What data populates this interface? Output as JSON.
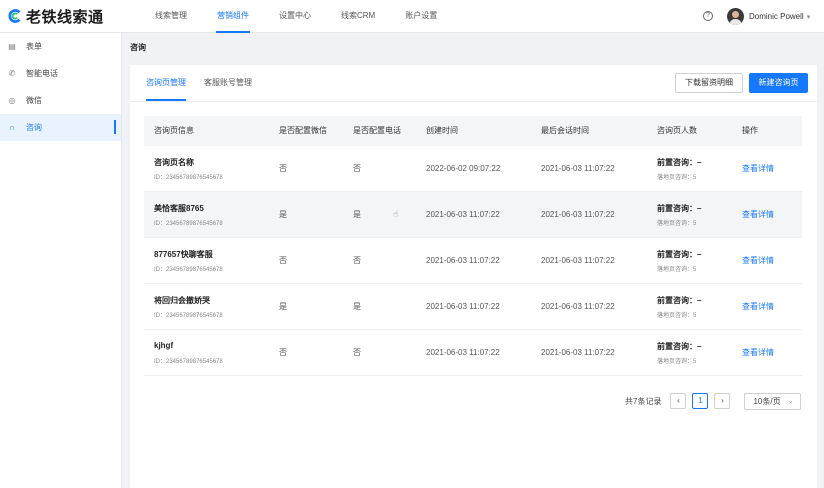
{
  "brand": {
    "name": "老铁线索通",
    "color": "#1677ff"
  },
  "topnav": {
    "items": [
      {
        "label": "线索管理"
      },
      {
        "label": "营销组件"
      },
      {
        "label": "设置中心"
      },
      {
        "label": "线索CRM"
      },
      {
        "label": "账户设置"
      }
    ],
    "active_index": 1,
    "help_glyph": "?",
    "user_name": "Dominic Powell"
  },
  "sidebar": {
    "items": [
      {
        "label": "表单",
        "icon": "form-icon"
      },
      {
        "label": "智能电话",
        "icon": "phone-icon"
      },
      {
        "label": "微信",
        "icon": "wechat-icon"
      },
      {
        "label": "咨询",
        "icon": "headset-icon"
      }
    ],
    "active_index": 3
  },
  "page": {
    "title": "咨询"
  },
  "tabs": [
    {
      "label": "咨询页管理"
    },
    {
      "label": "客服账号管理"
    }
  ],
  "actions": {
    "download": "下载留资明细",
    "create": "新建咨询页"
  },
  "table": {
    "columns": [
      "咨询页信息",
      "是否配置微信",
      "是否配置电话",
      "创建时间",
      "最后会话时间",
      "咨询页人数",
      "操作"
    ],
    "rows": [
      {
        "name": "咨询页名称",
        "id": "ID：23456789876545678",
        "wechat": "否",
        "phone": "否",
        "created": "2022-06-02 09:07:22",
        "last": "2021-06-03 11:07:22",
        "consult": "前置咨询：–",
        "landing": "落地页咨询：5",
        "action": "查看详情"
      },
      {
        "name": "美恰客服8765",
        "id": "ID：23456789876545678",
        "wechat": "是",
        "phone": "是",
        "created": "2021-06-03 11:07:22",
        "last": "2021-06-03 11:07:22",
        "consult": "前置咨询：–",
        "landing": "落地页咨询：5",
        "action": "查看详情"
      },
      {
        "name": "877657快聊客服",
        "id": "ID：23456789876545678",
        "wechat": "否",
        "phone": "否",
        "created": "2021-06-03 11:07:22",
        "last": "2021-06-03 11:07:22",
        "consult": "前置咨询：–",
        "landing": "落地页咨询：5",
        "action": "查看详情"
      },
      {
        "name": "将回归会撤娇哭",
        "id": "ID：23456789876545678",
        "wechat": "是",
        "phone": "是",
        "created": "2021-06-03 11:07:22",
        "last": "2021-06-03 11:07:22",
        "consult": "前置咨询：–",
        "landing": "落地页咨询：5",
        "action": "查看详情"
      },
      {
        "name": "kjhgf",
        "id": "ID：23456789876545678",
        "wechat": "否",
        "phone": "否",
        "created": "2021-06-03 11:07:22",
        "last": "2021-06-03 11:07:22",
        "consult": "前置咨询：–",
        "landing": "落地页咨询：5",
        "action": "查看详情"
      }
    ],
    "hover_row": 1
  },
  "pagination": {
    "total": "共7条记录",
    "prev": "‹",
    "current": "1",
    "next": "›",
    "page_size": "10条/页"
  }
}
